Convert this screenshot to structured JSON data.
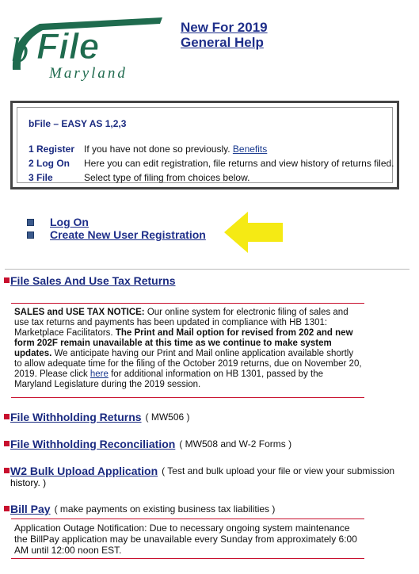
{
  "logo": {
    "alt": "bFile Maryland",
    "line1": "bFile",
    "line2": "Maryland"
  },
  "header_links": [
    "New For 2019",
    "General Help"
  ],
  "infobox": {
    "title": "bFile – EASY AS 1,2,3",
    "rows": [
      {
        "step": "1 Register",
        "desc": "If you have not done so previously.",
        "link": "Benefits"
      },
      {
        "step": "2 Log On",
        "desc": "Here you can edit registration, file returns and view history of returns filed."
      },
      {
        "step": "3 File",
        "desc": "Select type of filing from choices below."
      }
    ]
  },
  "login_links": [
    "Log On",
    "Create New User Registration"
  ],
  "sections": {
    "sales": {
      "title": "File Sales And Use Tax Returns"
    },
    "withholding": {
      "title": "File Withholding Returns",
      "aside": "( MW506 )"
    },
    "reconciliation": {
      "title": "File Withholding Reconciliation",
      "aside": "( MW508 and W-2 Forms )"
    },
    "w2": {
      "title": "W2 Bulk Upload Application",
      "aside_line1": "( Test and bulk upload your file or view your submission",
      "aside_line2": "history. )"
    },
    "billpay": {
      "title": "Bill Pay",
      "aside": "( make payments on existing business tax liabilities )"
    }
  },
  "sales_notice": {
    "label": "SALES and USE TAX NOTICE:",
    "text1": " Our online system for electronic filing of sales and use tax returns and payments has been updated in compliance with HB 1301: Marketplace Facilitators. ",
    "bold": "The Print and Mail option for revised from 202 and new form 202F remain unavailable at this time as we continue to make system updates.",
    "text2": " We anticipate having our Print and Mail online application available shortly to allow adequate time for the filing of the October 2019 returns, due on November 20, 2019. Please click ",
    "link": "here",
    "text3": " for additional information on HB 1301, passed by the Maryland Legislature during the 2019 session."
  },
  "billpay_notice": "Application Outage Notification: Due to necessary ongoing system maintenance the BillPay application may be unavailable every Sunday from approximately 6:00 AM until 12:00 noon EST.",
  "colors": {
    "logo_green": "#1f6b4e",
    "link_blue": "#1a2a80",
    "bullet_red": "#c8102e",
    "arrow_yellow": "#f5ea14"
  }
}
